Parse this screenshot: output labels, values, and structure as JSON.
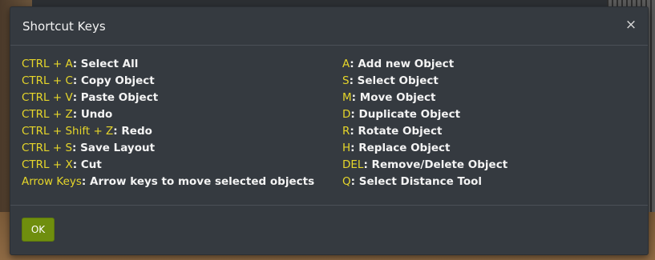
{
  "modal": {
    "title": "Shortcut Keys",
    "close_label": "×",
    "ok_label": "OK",
    "left_shortcuts": [
      {
        "key": "CTRL + A",
        "desc": ": Select All"
      },
      {
        "key": "CTRL + C",
        "desc": ": Copy Object"
      },
      {
        "key": "CTRL + V",
        "desc": ": Paste Object"
      },
      {
        "key": "CTRL + Z",
        "desc": ": Undo"
      },
      {
        "key": "CTRL + Shift + Z",
        "desc": ": Redo"
      },
      {
        "key": "CTRL + S",
        "desc": ": Save Layout"
      },
      {
        "key": "CTRL + X",
        "desc": ": Cut"
      },
      {
        "key": "Arrow Keys",
        "desc": ": Arrow keys to move selected objects"
      }
    ],
    "right_shortcuts": [
      {
        "key": "A",
        "desc": ": Add new Object"
      },
      {
        "key": "S",
        "desc": ": Select Object"
      },
      {
        "key": "M",
        "desc": ": Move Object"
      },
      {
        "key": "D",
        "desc": ": Duplicate Object"
      },
      {
        "key": "R",
        "desc": ": Rotate Object"
      },
      {
        "key": "H",
        "desc": ": Replace Object"
      },
      {
        "key": "DEL",
        "desc": ": Remove/Delete Object"
      },
      {
        "key": "Q",
        "desc": ": Select Distance Tool"
      }
    ]
  },
  "colors": {
    "key": "#e6d62a",
    "modal_bg": "#353a40",
    "ok_button": "#6f8e0e"
  }
}
